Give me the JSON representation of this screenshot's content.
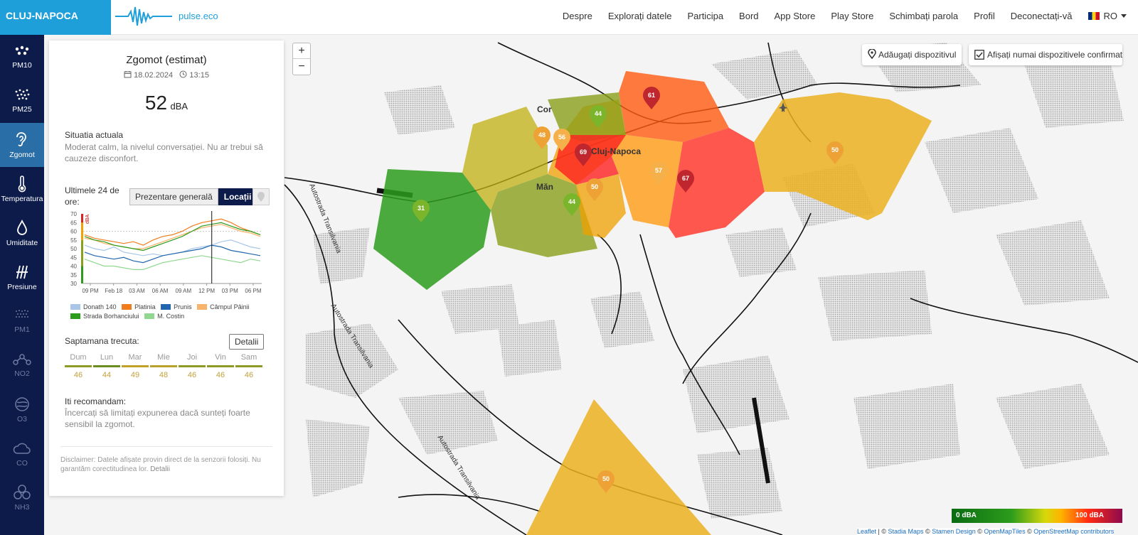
{
  "header": {
    "city": "CLUJ-NAPOCA",
    "logo_text": "pulse.eco",
    "nav": [
      "Despre",
      "Explorați datele",
      "Participa",
      "Bord",
      "App Store",
      "Play Store",
      "Schimbați parola",
      "Profil",
      "Deconectați-vă"
    ],
    "lang": "RO"
  },
  "sidebar": {
    "items": [
      {
        "label": "PM10",
        "icon": "pm10-icon"
      },
      {
        "label": "PM25",
        "icon": "pm25-icon"
      },
      {
        "label": "Zgomot",
        "icon": "ear-icon",
        "active": true
      },
      {
        "label": "Temperatura",
        "icon": "thermometer-icon"
      },
      {
        "label": "Umiditate",
        "icon": "droplet-icon"
      },
      {
        "label": "Presiune",
        "icon": "pressure-icon"
      },
      {
        "label": "PM1",
        "icon": "pm1-icon",
        "dim": true
      },
      {
        "label": "NO2",
        "icon": "no2-icon",
        "dim": true
      },
      {
        "label": "O3",
        "icon": "o3-icon",
        "dim": true
      },
      {
        "label": "CO",
        "icon": "cloud-icon",
        "dim": true
      },
      {
        "label": "NH3",
        "icon": "nh3-icon",
        "dim": true
      }
    ]
  },
  "panel": {
    "title": "Zgomot (estimat)",
    "date": "18.02.2024",
    "time": "13:15",
    "value": "52",
    "unit": "dBA",
    "situation_label": "Situatia actuala",
    "situation_text": "Moderat calm, la nivelul conversației. Nu ar trebui să cauzeze disconfort.",
    "last24_label": "Ultimele 24 de ore:",
    "btn_overview": "Prezentare generală",
    "btn_locations": "Locații",
    "last_week_label": "Saptamana trecuta:",
    "details_btn": "Detalii",
    "week": [
      {
        "day": "Dum",
        "value": "46"
      },
      {
        "day": "Lun",
        "value": "44"
      },
      {
        "day": "Mar",
        "value": "49"
      },
      {
        "day": "Mie",
        "value": "48"
      },
      {
        "day": "Joi",
        "value": "46"
      },
      {
        "day": "Vin",
        "value": "46"
      },
      {
        "day": "Sam",
        "value": "46"
      }
    ],
    "recommend_label": "Iti recomandam:",
    "recommend_text": "Încercați să limitați expunerea dacă sunteți foarte sensibil la zgomot.",
    "disclaimer_label": "Disclaimer:",
    "disclaimer_text": "Datele afișate provin direct de la senzorii folosiți. Nu garantăm corectitudinea lor.",
    "disclaimer_link": "Detalii"
  },
  "chart_data": {
    "type": "line",
    "ylabel": "dBA",
    "ylim": [
      30,
      70
    ],
    "yticks": [
      "70",
      "65",
      "60",
      "55",
      "50",
      "45",
      "40",
      "35",
      "30"
    ],
    "xticks": [
      "09 PM",
      "Feb 18",
      "03 AM",
      "06 AM",
      "09 AM",
      "12 PM",
      "03 PM",
      "06 PM"
    ],
    "series": [
      {
        "name": "Donath 140",
        "color": "#a9c6e8",
        "values": [
          52,
          50,
          49,
          51,
          48,
          47,
          46,
          47,
          46,
          47,
          48,
          50,
          51,
          52,
          54,
          55,
          53,
          51,
          50
        ]
      },
      {
        "name": "Platinia",
        "color": "#f07c1c",
        "values": [
          58,
          56,
          55,
          54,
          53,
          54,
          52,
          55,
          57,
          58,
          60,
          63,
          65,
          66,
          67,
          65,
          62,
          60,
          58
        ]
      },
      {
        "name": "Prunis",
        "color": "#2166ac",
        "values": [
          48,
          46,
          45,
          44,
          45,
          43,
          42,
          44,
          46,
          47,
          48,
          49,
          50,
          52,
          51,
          49,
          48,
          47,
          46
        ]
      },
      {
        "name": "Câmpul Pâinii",
        "color": "#f7b26b",
        "values": [
          56,
          55,
          53,
          52,
          51,
          50,
          50,
          52,
          54,
          56,
          58,
          60,
          62,
          63,
          64,
          62,
          60,
          59,
          57
        ]
      },
      {
        "name": "Strada Borhanciului",
        "color": "#2d9c1c",
        "values": [
          57,
          55,
          54,
          52,
          51,
          50,
          49,
          51,
          53,
          55,
          57,
          60,
          63,
          64,
          65,
          63,
          61,
          60,
          58
        ]
      },
      {
        "name": "M. Costin",
        "color": "#90d890",
        "values": [
          44,
          42,
          40,
          40,
          39,
          38,
          38,
          40,
          42,
          43,
          44,
          45,
          46,
          45,
          44,
          43,
          42,
          44,
          43
        ]
      }
    ]
  },
  "map": {
    "add_device": "Adăugați dispozitivul",
    "confirmed_only": "Afișați numai dispozitivele confirmate",
    "zoom_in": "+",
    "zoom_out": "−",
    "place_labels": [
      "Cor",
      "Cluj-Napoca",
      "Măn",
      "Autostrada Transilvania",
      "Autostrada Transilvania",
      "Autostrada Transilvania"
    ],
    "markers": [
      {
        "value": "61",
        "color": "#c0262d"
      },
      {
        "value": "44",
        "color": "#7bb52c"
      },
      {
        "value": "48",
        "color": "#eea236"
      },
      {
        "value": "56",
        "color": "#f5b04a"
      },
      {
        "value": "69",
        "color": "#c0262d"
      },
      {
        "value": "57",
        "color": "#f5b04a"
      },
      {
        "value": "67",
        "color": "#c0262d"
      },
      {
        "value": "50",
        "color": "#eea236"
      },
      {
        "value": "44",
        "color": "#7bb52c"
      },
      {
        "value": "31",
        "color": "#7bb52c"
      },
      {
        "value": "50",
        "color": "#eea236"
      },
      {
        "value": "50",
        "color": "#eea236"
      }
    ],
    "scale_min": "0 dBA",
    "scale_max": "100 dBA",
    "attribution": [
      "Leaflet",
      " | © ",
      "Stadia Maps",
      " © ",
      "Stamen Design",
      " © ",
      "OpenMapTiles",
      " © ",
      "OpenStreetMap contributors"
    ]
  }
}
